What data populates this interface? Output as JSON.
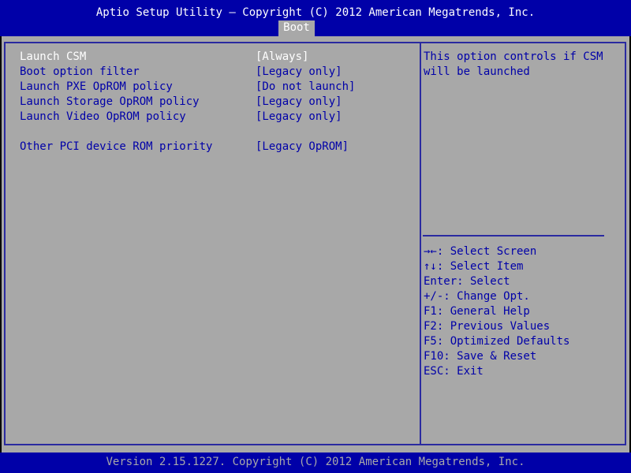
{
  "header": {
    "title": "Aptio Setup Utility – Copyright (C) 2012 American Megatrends, Inc.",
    "active_tab": "Boot"
  },
  "settings": [
    {
      "label": "Launch CSM",
      "value": "[Always]"
    },
    {
      "label": "Boot option filter",
      "value": "[Legacy only]"
    },
    {
      "label": "Launch PXE OpROM policy",
      "value": "[Do not launch]"
    },
    {
      "label": "Launch Storage OpROM policy",
      "value": "[Legacy only]"
    },
    {
      "label": "Launch Video OpROM policy",
      "value": "[Legacy only]"
    },
    {
      "label": "Other PCI device ROM priority",
      "value": "[Legacy OpROM]"
    }
  ],
  "help": {
    "lines": [
      "This option controls if CSM",
      "will be launched"
    ]
  },
  "keys": [
    "→←: Select Screen",
    "↑↓: Select Item",
    "Enter: Select",
    "+/-: Change Opt.",
    "F1: General Help",
    "F2: Previous Values",
    "F5: Optimized Defaults",
    "F10: Save & Reset",
    "ESC: Exit"
  ],
  "footer": {
    "text": "Version 2.15.1227. Copyright (C) 2012 American Megatrends, Inc."
  },
  "colors": {
    "background": "#a8a8a8",
    "header": "#0000a8",
    "text": "#0000a8",
    "selected_text": "#ffffff",
    "frame": "#2a2aa0"
  }
}
